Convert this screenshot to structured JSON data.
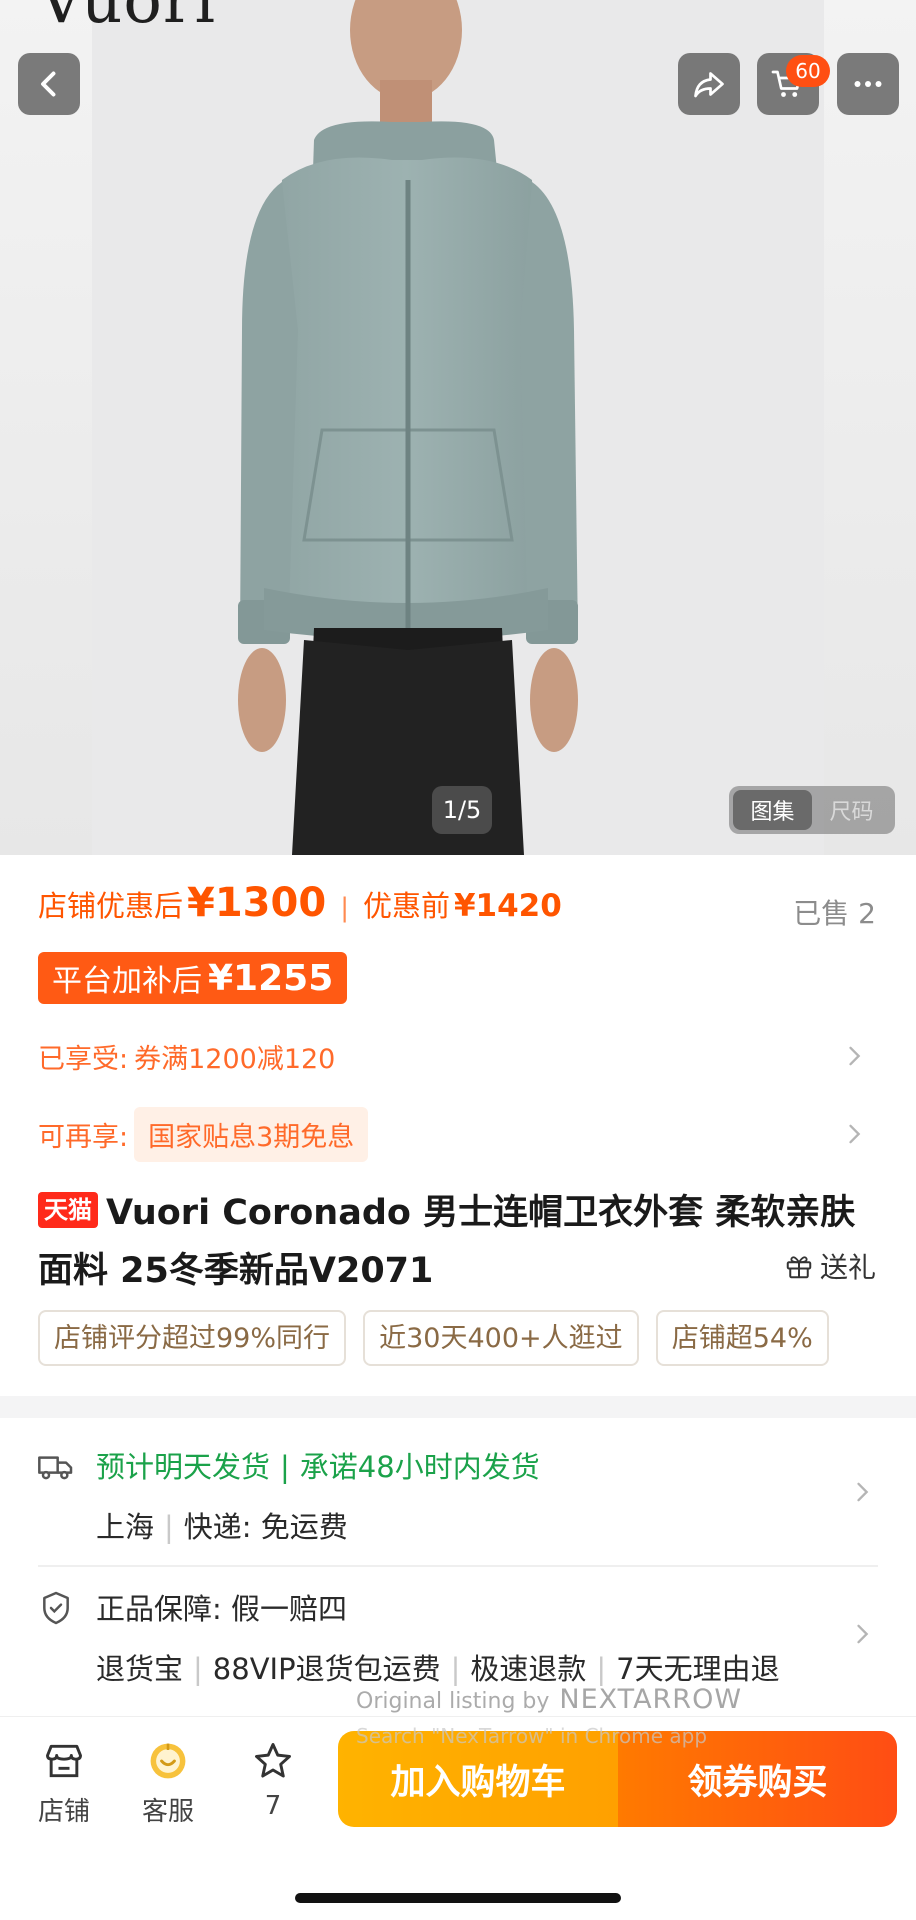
{
  "hero": {
    "brand_word": "Vuori",
    "cart_count": "60",
    "image_counter": "1/5",
    "gallery_tabs": [
      "图集",
      "尺码"
    ]
  },
  "price": {
    "after_label": "店铺优惠后",
    "after_value": "¥1300",
    "separator": "|",
    "before_label": "优惠前",
    "before_value": "¥1420",
    "sold": "已售 2",
    "subsidy_label": "平台加补后",
    "subsidy_value": "¥1255"
  },
  "promos": [
    {
      "label": "已享受:",
      "value": "券满1200减120"
    },
    {
      "label": "可再享:",
      "value": "国家贴息3期免息"
    }
  ],
  "title": {
    "tag": "天猫",
    "line1": "Vuori Coronado 男士连帽卫衣外套 柔软亲肤",
    "line2": "面料 25冬季新品V2071",
    "gift": "送礼"
  },
  "badges": [
    "店铺评分超过99%同行",
    "近30天400+人逛过",
    "店铺超54%"
  ],
  "shipping": {
    "eta": "预计明天发货",
    "promise": "承诺48小时内发货",
    "origin": "上海",
    "delivery": "快递: 免运费"
  },
  "guarantee": {
    "title": "正品保障: 假一赔四",
    "items": [
      "退货宝",
      "88VIP退货包运费",
      "极速退款",
      "7天无理由退"
    ]
  },
  "watermark": {
    "line1": "Original listing by",
    "brand": "NEXTARROW",
    "line2": "Search \"NexTarrow\" in Chrome app"
  },
  "bottom_bar": {
    "shop": "店铺",
    "service": "客服",
    "fav_count": "7",
    "add_to_cart": "加入购物车",
    "buy": "领券购买"
  },
  "colors": {
    "accent": "#ff5500",
    "ship_green": "#1ba24a",
    "cart_button": "#ffa000",
    "buy_button": "#ff4d14"
  }
}
